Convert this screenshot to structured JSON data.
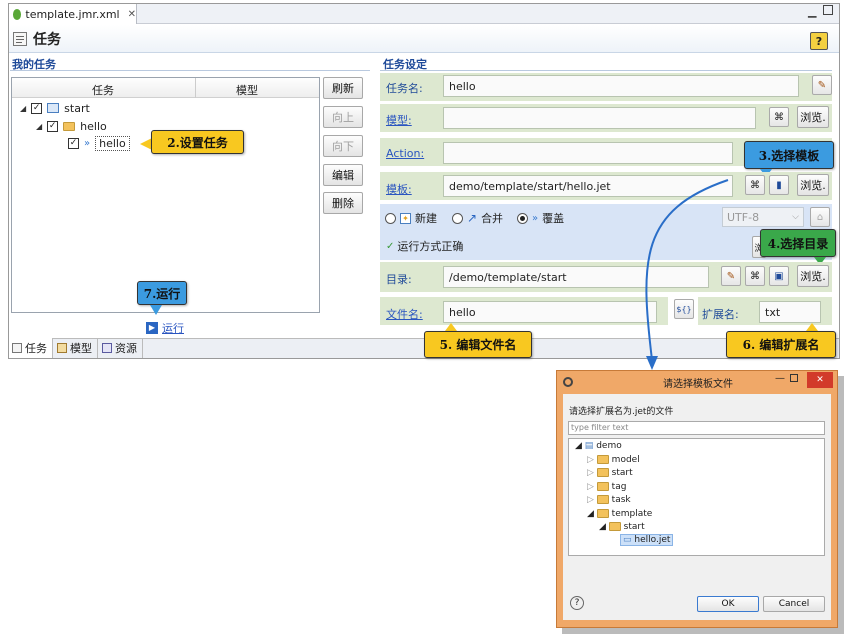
{
  "editor": {
    "tab_title": "template.jmr.xml",
    "page_title": "任务"
  },
  "left": {
    "section_title": "我的任务",
    "columns": [
      "任务",
      "模型"
    ],
    "tree": [
      {
        "label": "start"
      },
      {
        "label": "hello"
      },
      {
        "label": "hello"
      }
    ],
    "buttons": {
      "refresh": "刷新",
      "up": "向上",
      "down": "向下",
      "edit": "编辑",
      "delete": "删除"
    },
    "run_label": "运行"
  },
  "bottom_tabs": [
    "任务",
    "模型",
    "资源"
  ],
  "right": {
    "section_title": "任务设定",
    "task_name_label": "任务名:",
    "task_name_value": "hello",
    "model_label": "模型:",
    "model_value": "",
    "action_label": "Action:",
    "action_value": "",
    "template_label": "模板:",
    "template_value": "demo/template/start/hello.jet",
    "browse": "浏览.",
    "mode_new": "新建",
    "mode_merge": "合并",
    "mode_overwrite": "覆盖",
    "encoding": "UTF-8",
    "status": "运行方式正确",
    "dir_label": "目录:",
    "dir_value": "/demo/template/start",
    "filename_label": "文件名:",
    "filename_value": "hello",
    "ext_label": "扩展名:",
    "ext_value": "txt"
  },
  "callouts": {
    "c2": "2.设置任务",
    "c3": "3.选择模板",
    "c4": "4.选择目录",
    "c5": "5. 编辑文件名",
    "c6": "6. 编辑扩展名",
    "c7": "7.运行"
  },
  "dialog": {
    "title": "请选择模板文件",
    "prompt": "请选择扩展名为.jet的文件",
    "filter_placeholder": "type filter text",
    "tree": [
      "demo",
      "model",
      "start",
      "tag",
      "task",
      "template",
      "start",
      "hello.jet"
    ],
    "ok": "OK",
    "cancel": "Cancel"
  },
  "colors": {
    "section_title": "#1f4a99",
    "field_bg": "#dde8d0",
    "radio_bg": "#d8e4f6",
    "callout_yellow": "#f8c820",
    "callout_green": "#3aa84a",
    "callout_blue": "#3b9be0"
  }
}
